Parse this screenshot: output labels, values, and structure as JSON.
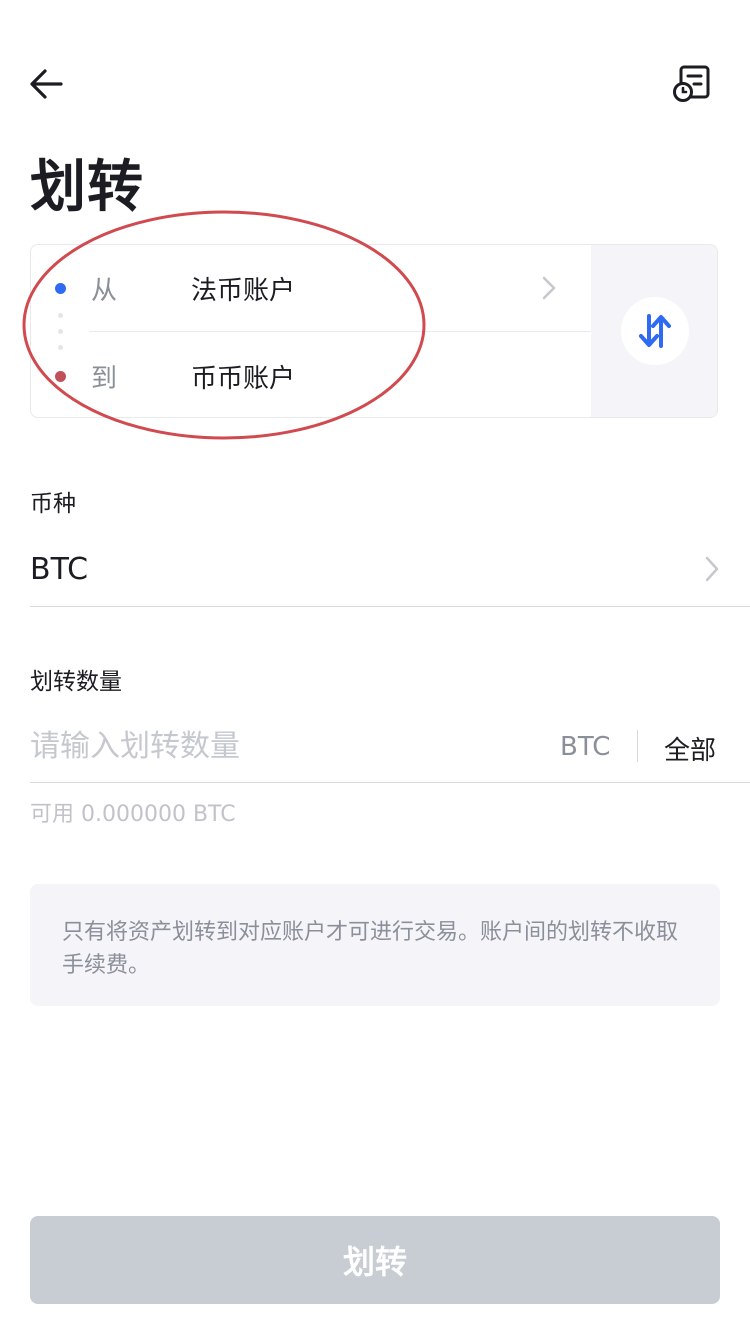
{
  "header": {
    "back_icon": "arrow-left-icon",
    "record_icon": "transfer-record-icon",
    "title": "划转"
  },
  "transfer": {
    "from": {
      "label": "从",
      "account": "法币账户"
    },
    "to": {
      "label": "到",
      "account": "币币账户"
    },
    "swap_icon": "swap-arrows-icon"
  },
  "coin": {
    "label": "币种",
    "value": "BTC"
  },
  "amount": {
    "label": "划转数量",
    "placeholder": "请输入划转数量",
    "value": "",
    "unit": "BTC",
    "all_label": "全部",
    "available": "可用 0.000000 BTC"
  },
  "notice": {
    "text": "只有将资产划转到对应账户才可进行交易。账户间的划转不收取手续费。"
  },
  "submit": {
    "label": "划转",
    "enabled": false
  },
  "colors": {
    "accent": "#2f6af2",
    "from_dot": "#2f6af2",
    "to_dot": "#c0505a",
    "annotation": "#d04a4f",
    "button_disabled": "#c8ccd3"
  }
}
